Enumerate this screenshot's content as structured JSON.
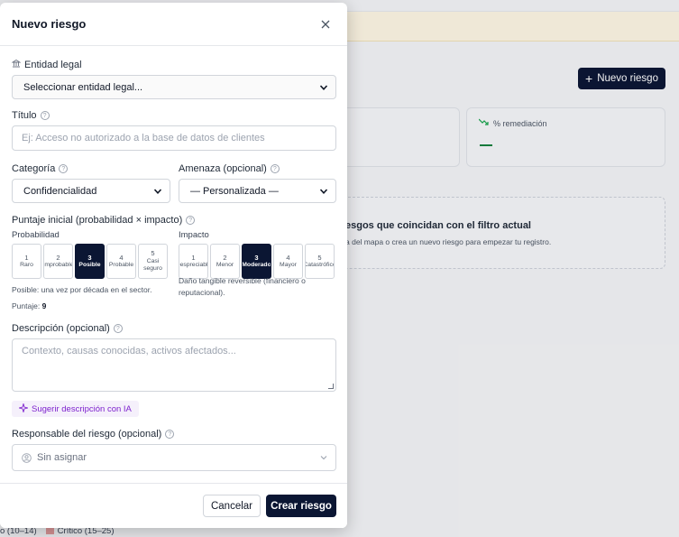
{
  "background": {
    "new_risk_button": "Nuevo riesgo",
    "card_remediation_label": "% remediación",
    "card_remediation_value": "—",
    "empty_title": "esgos que coincidan con el filtro actual",
    "empty_subtitle": "a del mapa o crea un nuevo riesgo para empezar tu registro.",
    "legend_left": "o (10–14)",
    "legend_critical": "Crítico (15–25)"
  },
  "modal": {
    "title": "Nuevo riesgo",
    "legal_entity": {
      "label": "Entidad legal",
      "value": "Seleccionar entidad legal..."
    },
    "title_field": {
      "label": "Título",
      "placeholder": "Ej: Acceso no autorizado a la base de datos de clientes"
    },
    "category": {
      "label": "Categoría",
      "value": "Confidencialidad"
    },
    "threat": {
      "label": "Amenaza (opcional)",
      "value": "— Personalizada —"
    },
    "score": {
      "label": "Puntaje inicial (probabilidad × impacto)",
      "probability_label": "Probabilidad",
      "probability_options": [
        {
          "num": "1",
          "label": "Raro"
        },
        {
          "num": "2",
          "label": "Improbable"
        },
        {
          "num": "3",
          "label": "Posible"
        },
        {
          "num": "4",
          "label": "Probable"
        },
        {
          "num": "5",
          "label": "Casi seguro"
        }
      ],
      "probability_selected": 3,
      "probability_hint": "Posible: una vez por década en el sector.",
      "impact_label": "Impacto",
      "impact_options": [
        {
          "num": "1",
          "label": "Despreciable"
        },
        {
          "num": "2",
          "label": "Menor"
        },
        {
          "num": "3",
          "label": "Moderado"
        },
        {
          "num": "4",
          "label": "Mayor"
        },
        {
          "num": "5",
          "label": "Catastrófico"
        }
      ],
      "impact_selected": 3,
      "impact_hint": "Daño tangible reversible (financiero o reputacional).",
      "score_label": "Puntaje:",
      "score_value": "9"
    },
    "description": {
      "label": "Descripción (opcional)",
      "placeholder": "Contexto, causas conocidas, activos afectados..."
    },
    "ai_suggest": "Sugerir descripción con IA",
    "owner": {
      "label": "Responsable del riesgo (opcional)",
      "value": "Sin asignar"
    },
    "cancel": "Cancelar",
    "create": "Crear riesgo"
  },
  "colors": {
    "primary": "#0b1633",
    "ai_accent": "#7e22ce",
    "banner": "#fdf6e3"
  }
}
